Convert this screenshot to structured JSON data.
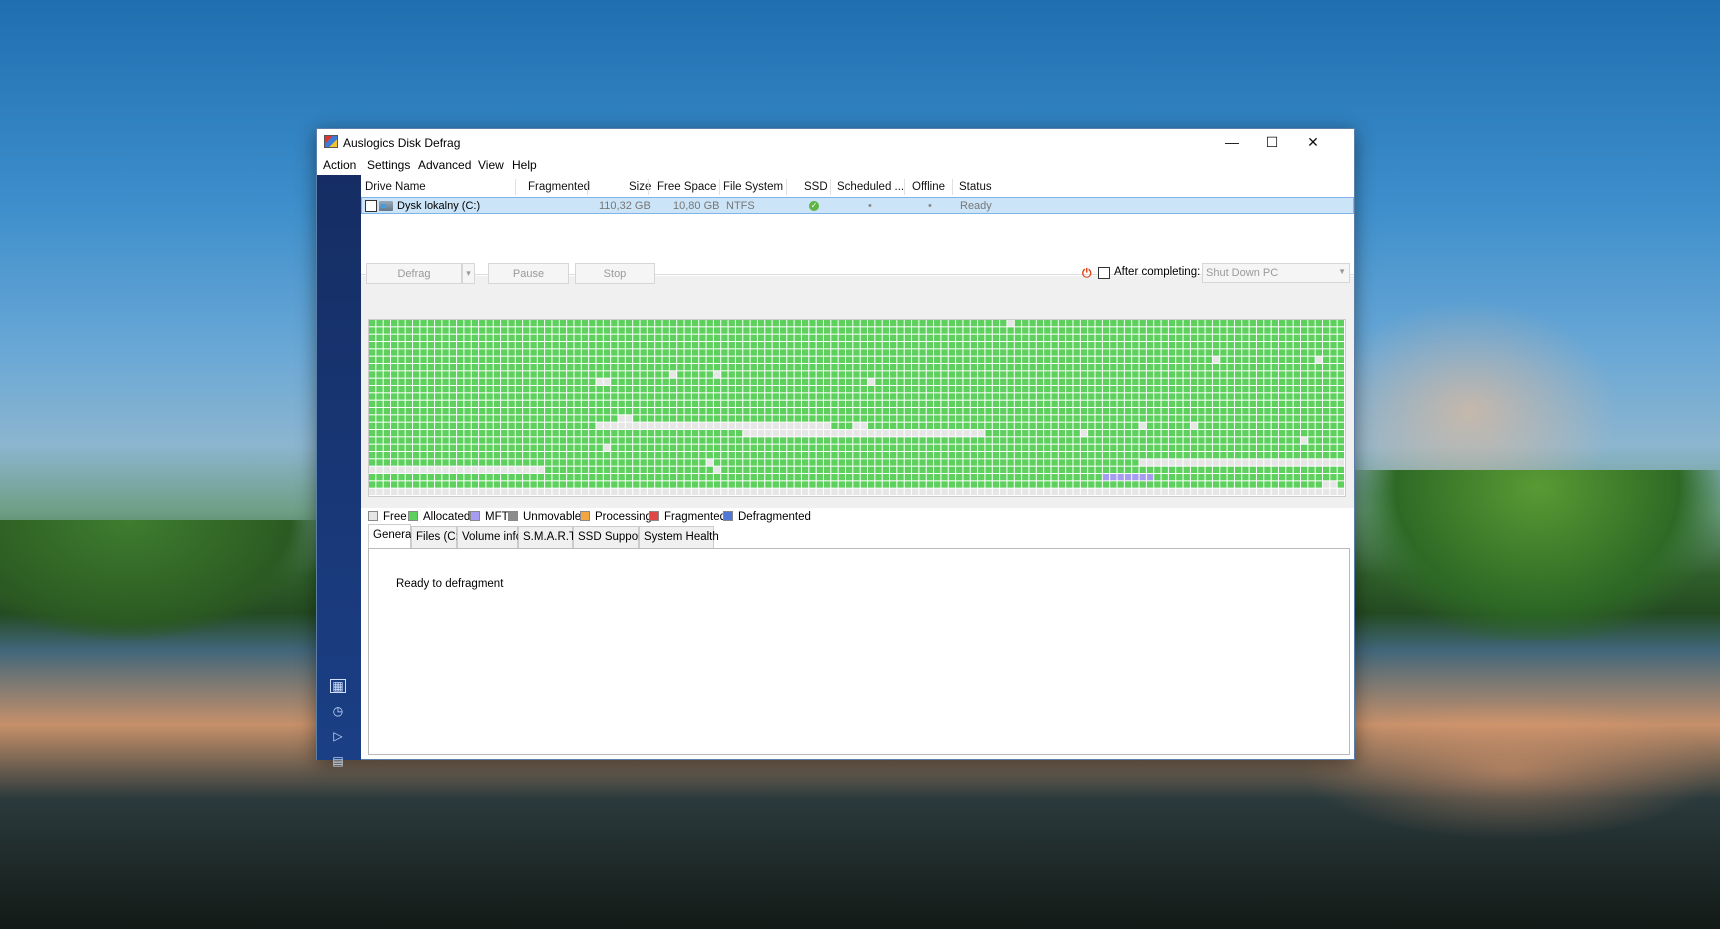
{
  "window": {
    "title": "Auslogics Disk Defrag"
  },
  "window_controls": {
    "minimize": "—",
    "maximize": "☐",
    "close": "✕"
  },
  "menu": [
    "Action",
    "Settings",
    "Advanced",
    "View",
    "Help"
  ],
  "sidebar": {
    "icons": [
      "map-icon",
      "clock-icon",
      "console-icon",
      "report-icon"
    ],
    "glyphs": [
      "▦",
      "◷",
      "▷",
      "▤"
    ],
    "selected": 0
  },
  "drive_list": {
    "columns": [
      "Drive Name",
      "Fragmented",
      "Size",
      "Free Space",
      "File System",
      "SSD",
      "Scheduled ...",
      "Offline",
      "Status"
    ],
    "rows": [
      {
        "name": "Dysk lokalny (C:)",
        "fragmented": "",
        "size": "110,32 GB",
        "free_space": "10,80 GB",
        "file_system": "NTFS",
        "ssd": true,
        "scheduled": "•",
        "offline": "•",
        "status": "Ready",
        "checked": false,
        "selected": true
      }
    ]
  },
  "toolbar": {
    "defrag_label": "Defrag",
    "dropdown_arrow": "▾",
    "pause_label": "Pause",
    "stop_label": "Stop",
    "after_completing_label": "After completing:",
    "after_completing_checked": false,
    "after_completing_value": "Shut Down PC",
    "power_glyph": "⏻"
  },
  "colors": {
    "free": "#e6e6e6",
    "allocated": "#5ed05e",
    "mft": "#a69cf0",
    "unmovable": "#8c8c8c",
    "processing": "#f2a540",
    "fragmented": "#e04848",
    "defragmented": "#4f78d8",
    "accent_selection": "#cce4f7"
  },
  "legend": [
    {
      "label": "Free",
      "key": "free"
    },
    {
      "label": "Allocated",
      "key": "allocated"
    },
    {
      "label": "MFT",
      "key": "mft"
    },
    {
      "label": "Unmovable",
      "key": "unmovable"
    },
    {
      "label": "Processing",
      "key": "processing"
    },
    {
      "label": "Fragmented",
      "key": "fragmented"
    },
    {
      "label": "Defragmented",
      "key": "defragmented"
    }
  ],
  "tabs": [
    "General",
    "Files (C:)",
    "Volume info",
    "S.M.A.R.T.",
    "SSD Support",
    "System Health"
  ],
  "active_tab": 0,
  "general": {
    "status_text": "Ready to defragment"
  },
  "cluster_map": {
    "cols": 133,
    "rows": 24,
    "default": "allocated",
    "runs": [
      {
        "row": 0,
        "col": 87,
        "len": 1,
        "state": "free"
      },
      {
        "row": 5,
        "col": 115,
        "len": 1,
        "state": "free"
      },
      {
        "row": 5,
        "col": 129,
        "len": 1,
        "state": "free"
      },
      {
        "row": 7,
        "col": 41,
        "len": 1,
        "state": "free"
      },
      {
        "row": 7,
        "col": 47,
        "len": 1,
        "state": "free"
      },
      {
        "row": 8,
        "col": 31,
        "len": 2,
        "state": "free"
      },
      {
        "row": 8,
        "col": 68,
        "len": 1,
        "state": "free"
      },
      {
        "row": 13,
        "col": 34,
        "len": 2,
        "state": "free"
      },
      {
        "row": 14,
        "col": 31,
        "len": 32,
        "state": "free"
      },
      {
        "row": 14,
        "col": 66,
        "len": 2,
        "state": "free"
      },
      {
        "row": 14,
        "col": 105,
        "len": 1,
        "state": "free"
      },
      {
        "row": 14,
        "col": 112,
        "len": 1,
        "state": "free"
      },
      {
        "row": 15,
        "col": 51,
        "len": 33,
        "state": "free"
      },
      {
        "row": 15,
        "col": 97,
        "len": 1,
        "state": "free"
      },
      {
        "row": 16,
        "col": 127,
        "len": 1,
        "state": "free"
      },
      {
        "row": 17,
        "col": 32,
        "len": 1,
        "state": "free"
      },
      {
        "row": 19,
        "col": 46,
        "len": 1,
        "state": "free"
      },
      {
        "row": 19,
        "col": 105,
        "len": 28,
        "state": "free"
      },
      {
        "row": 20,
        "col": 0,
        "len": 24,
        "state": "free"
      },
      {
        "row": 20,
        "col": 47,
        "len": 1,
        "state": "free"
      },
      {
        "row": 21,
        "col": 100,
        "len": 7,
        "state": "mft"
      },
      {
        "row": 22,
        "col": 130,
        "len": 2,
        "state": "free"
      },
      {
        "row": 23,
        "col": 0,
        "len": 133,
        "state": "free"
      }
    ]
  }
}
